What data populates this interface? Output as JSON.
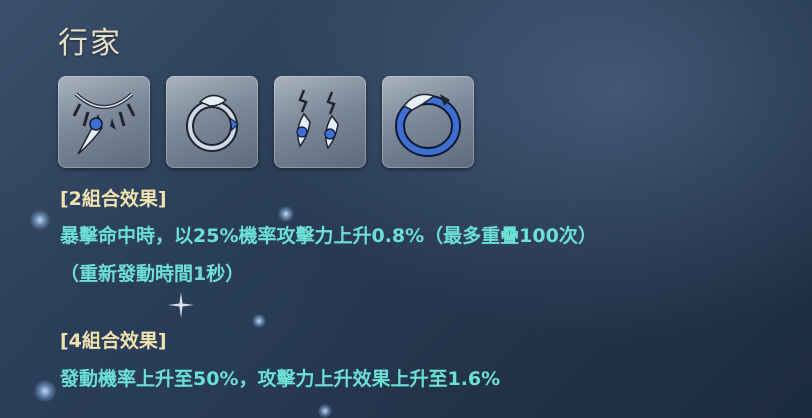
{
  "panel": {
    "title": "行家"
  },
  "items": [
    {
      "icon": "necklace-icon"
    },
    {
      "icon": "ring-icon"
    },
    {
      "icon": "earrings-icon"
    },
    {
      "icon": "bracelet-icon"
    }
  ],
  "set_bonus_2": {
    "header": "[2組合效果]",
    "line1": "暴擊命中時，以25%機率攻擊力上升0.8%（最多重疊100次）",
    "line2": "（重新發動時間1秒）"
  },
  "set_bonus_4": {
    "header": "[4組合效果]",
    "line1": "發動機率上升至50%，攻擊力上升效果上升至1.6%"
  },
  "colors": {
    "title": "#e9dfc7",
    "header": "#f0e3b0",
    "effect": "#6de0d6",
    "gem_blue": "#3f6fd0"
  }
}
